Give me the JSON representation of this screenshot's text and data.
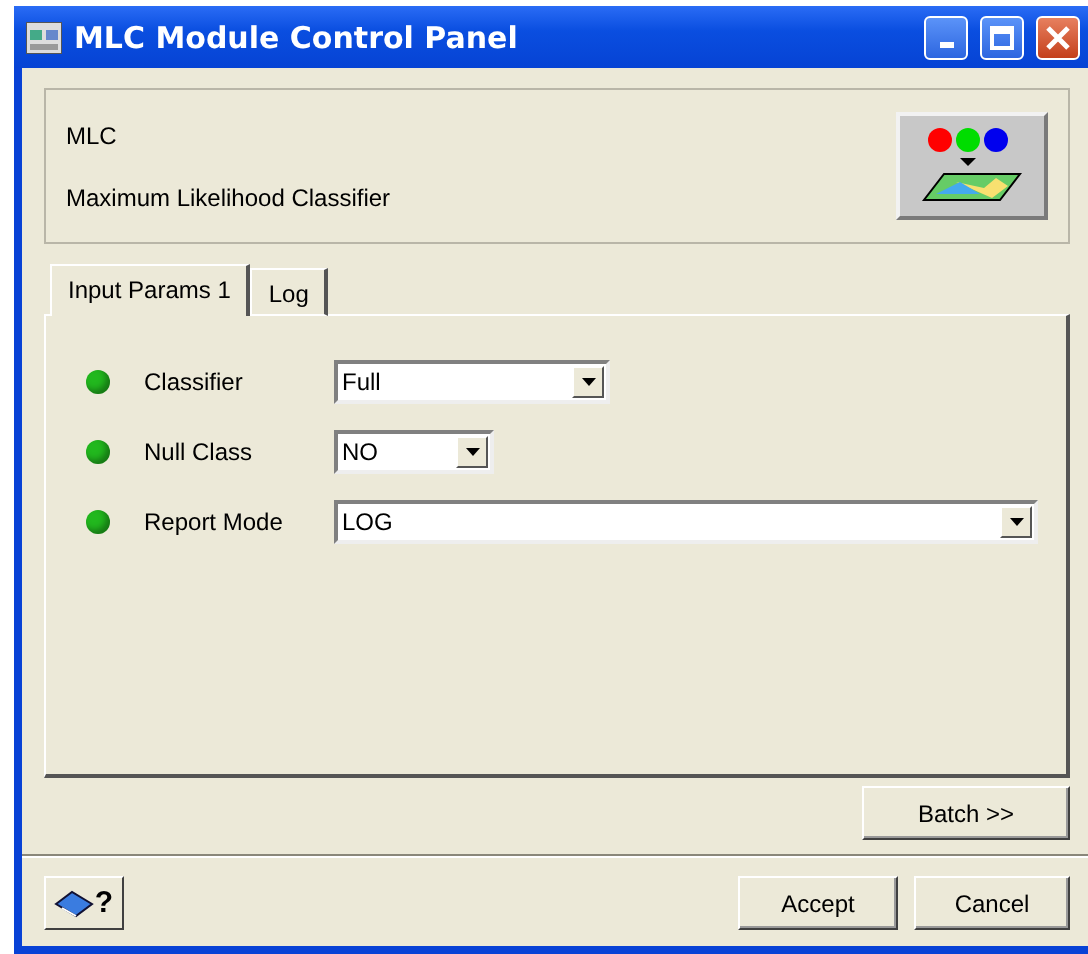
{
  "window": {
    "title": "MLC Module Control Panel"
  },
  "header": {
    "name": "MLC",
    "description": "Maximum Likelihood Classifier"
  },
  "tabs": [
    {
      "label": "Input Params 1",
      "selected": true
    },
    {
      "label": "Log",
      "selected": false
    }
  ],
  "params": [
    {
      "label": "Classifier",
      "value": "Full",
      "color": "#22b81e"
    },
    {
      "label": "Null Class",
      "value": "NO",
      "color": "#22b81e"
    },
    {
      "label": "Report Mode",
      "value": "LOG",
      "color": "#22b81e"
    }
  ],
  "batch_button": "Batch >>",
  "help_button": {
    "label": "?"
  },
  "buttons": [
    "Accept",
    "Cancel"
  ]
}
